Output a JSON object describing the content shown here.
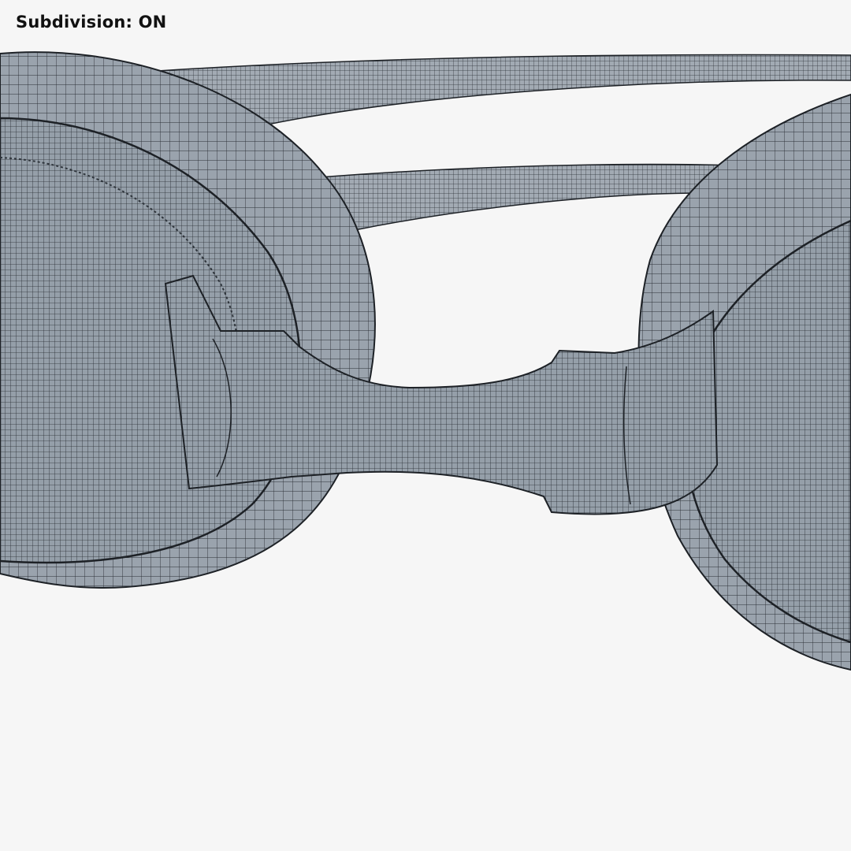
{
  "overlay": {
    "label_text": "Subdivision:",
    "state_text": "ON"
  },
  "render": {
    "subject": "goggles-wireframe",
    "background_color": "#f6f6f6",
    "mesh_fill_color": "#9aa3ad",
    "wire_color": "#2a2f35"
  }
}
